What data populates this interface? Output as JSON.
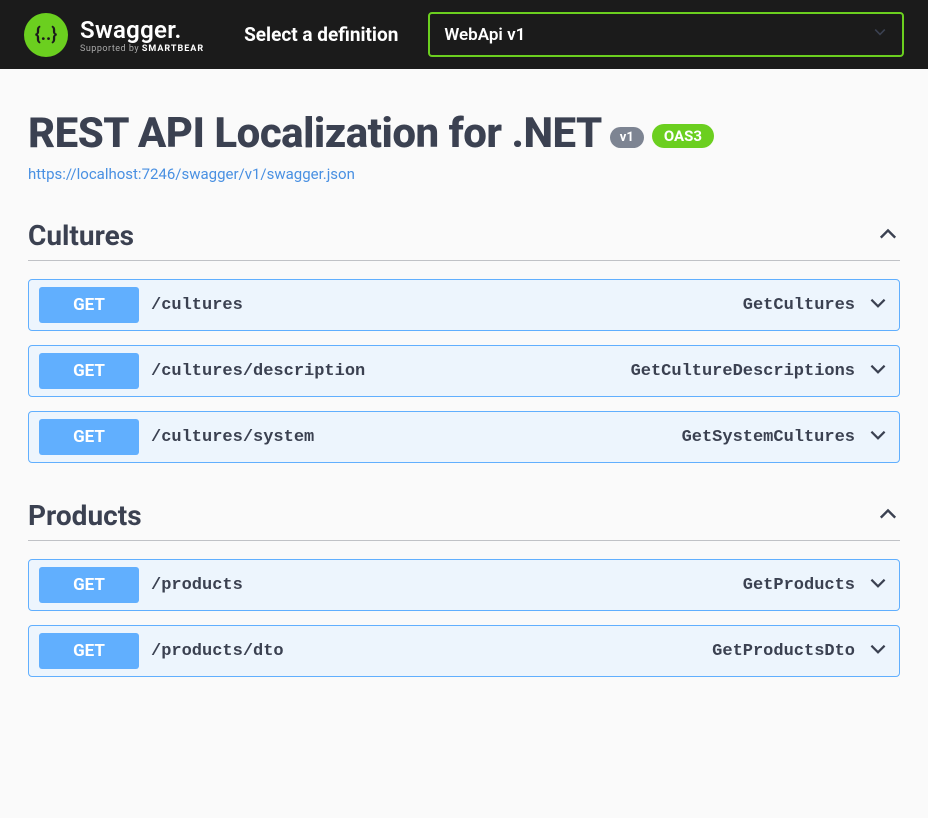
{
  "topbar": {
    "logo_glyph": "{..}",
    "logo_name": "Swagger.",
    "supported_prefix": "Supported by ",
    "supported_brand": "SMARTBEAR",
    "select_label": "Select a definition",
    "selected_definition": "WebApi v1"
  },
  "header": {
    "title": "REST API Localization for .NET",
    "version_badge": "v1",
    "oas_badge": "OAS3",
    "spec_url": "https://localhost:7246/swagger/v1/swagger.json"
  },
  "tags": [
    {
      "name": "Cultures",
      "ops": [
        {
          "method": "GET",
          "path": "/cultures",
          "opid": "GetCultures"
        },
        {
          "method": "GET",
          "path": "/cultures/description",
          "opid": "GetCultureDescriptions"
        },
        {
          "method": "GET",
          "path": "/cultures/system",
          "opid": "GetSystemCultures"
        }
      ]
    },
    {
      "name": "Products",
      "ops": [
        {
          "method": "GET",
          "path": "/products",
          "opid": "GetProducts"
        },
        {
          "method": "GET",
          "path": "/products/dto",
          "opid": "GetProductsDto"
        }
      ]
    }
  ]
}
